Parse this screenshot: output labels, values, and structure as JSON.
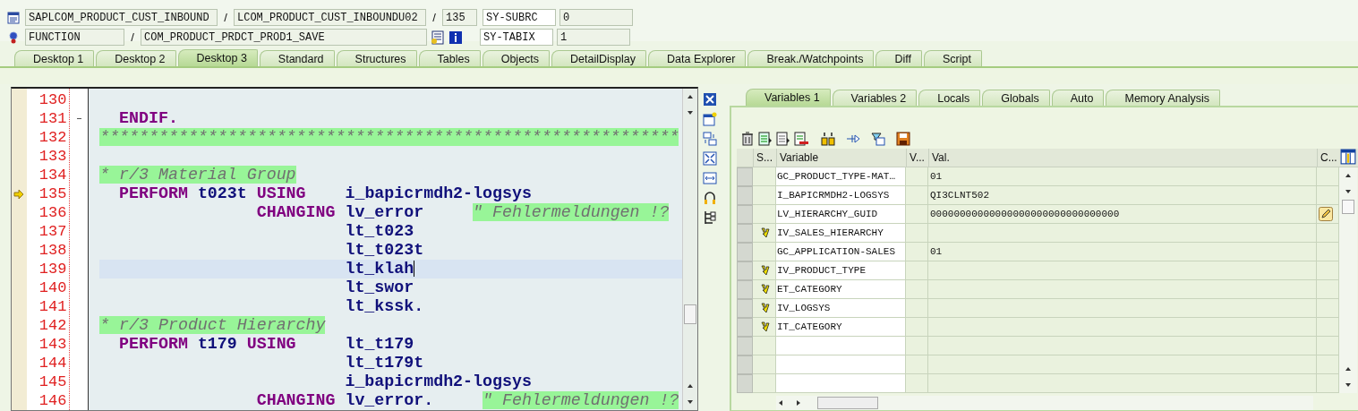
{
  "header": {
    "program": "SAPLCOM_PRODUCT_CUST_INBOUND",
    "include": "LCOM_PRODUCT_CUST_INBOUNDU02",
    "line": "135",
    "subrc_label": "SY-SUBRC",
    "subrc": "0",
    "event_type": "FUNCTION",
    "event_name": "COM_PRODUCT_PRDCT_PROD1_SAVE",
    "tabix_label": "SY-TABIX",
    "tabix": "1",
    "separator": "/"
  },
  "desktop_tabs": [
    {
      "label": "Desktop 1",
      "selected": false
    },
    {
      "label": "Desktop 2",
      "selected": false
    },
    {
      "label": "Desktop 3",
      "selected": true
    },
    {
      "label": "Standard",
      "selected": false
    },
    {
      "label": "Structures",
      "selected": false
    },
    {
      "label": "Tables",
      "selected": false
    },
    {
      "label": "Objects",
      "selected": false
    },
    {
      "label": "DetailDisplay",
      "selected": false
    },
    {
      "label": "Data Explorer",
      "selected": false
    },
    {
      "label": "Break./Watchpoints",
      "selected": false
    },
    {
      "label": "Diff",
      "selected": false
    },
    {
      "label": "Script",
      "selected": false
    }
  ],
  "code_lines": [
    {
      "number": "130",
      "current": false,
      "executing": false,
      "fold": false
    },
    {
      "number": "131",
      "current": false,
      "executing": false,
      "fold": true,
      "segments": [
        {
          "kind": "keyword",
          "t": "  ENDIF."
        }
      ]
    },
    {
      "number": "132",
      "current": false,
      "executing": false,
      "fold": false,
      "segments": [
        {
          "kind": "comment",
          "t": "***********************************************************"
        }
      ]
    },
    {
      "number": "133",
      "current": false,
      "executing": false,
      "fold": false
    },
    {
      "number": "134",
      "current": false,
      "executing": false,
      "fold": false,
      "segments": [
        {
          "kind": "comment",
          "t": "* r/3 Material Group"
        }
      ]
    },
    {
      "number": "135",
      "current": false,
      "executing": true,
      "fold": false,
      "segments": [
        {
          "kind": "keyword",
          "t": "  PERFORM"
        },
        {
          "kind": "identifier",
          "t": " t023t"
        },
        {
          "kind": "keyword",
          "t": " USING"
        },
        {
          "kind": "identifier",
          "t": "    i_bapicrmdh2-logsys"
        }
      ]
    },
    {
      "number": "136",
      "current": false,
      "executing": false,
      "fold": false,
      "segments": [
        {
          "kind": "keyword",
          "t": "                CHANGING"
        },
        {
          "kind": "identifier",
          "t": " lv_error     "
        },
        {
          "kind": "comment",
          "t": "\" Fehlermeldungen !?"
        }
      ]
    },
    {
      "number": "137",
      "current": false,
      "executing": false,
      "fold": false,
      "segments": [
        {
          "kind": "identifier",
          "t": "                         lt_t023"
        }
      ]
    },
    {
      "number": "138",
      "current": false,
      "executing": false,
      "fold": false,
      "segments": [
        {
          "kind": "identifier",
          "t": "                         lt_t023t"
        }
      ]
    },
    {
      "number": "139",
      "current": true,
      "executing": false,
      "fold": false,
      "segments": [
        {
          "kind": "identifier",
          "t": "                         lt_klah"
        }
      ]
    },
    {
      "number": "140",
      "current": false,
      "executing": false,
      "fold": false,
      "segments": [
        {
          "kind": "identifier",
          "t": "                         lt_swor"
        }
      ]
    },
    {
      "number": "141",
      "current": false,
      "executing": false,
      "fold": false,
      "segments": [
        {
          "kind": "identifier",
          "t": "                         lt_kssk."
        }
      ]
    },
    {
      "number": "142",
      "current": false,
      "executing": false,
      "fold": false,
      "segments": [
        {
          "kind": "comment",
          "t": "* r/3 Product Hierarchy"
        }
      ]
    },
    {
      "number": "143",
      "current": false,
      "executing": false,
      "fold": false,
      "segments": [
        {
          "kind": "keyword",
          "t": "  PERFORM"
        },
        {
          "kind": "identifier",
          "t": " t179"
        },
        {
          "kind": "keyword",
          "t": " USING"
        },
        {
          "kind": "identifier",
          "t": "     lt_t179"
        }
      ]
    },
    {
      "number": "144",
      "current": false,
      "executing": false,
      "fold": false,
      "segments": [
        {
          "kind": "identifier",
          "t": "                         lt_t179t"
        }
      ]
    },
    {
      "number": "145",
      "current": false,
      "executing": false,
      "fold": false,
      "segments": [
        {
          "kind": "identifier",
          "t": "                         i_bapicrmdh2-logsys"
        }
      ]
    },
    {
      "number": "146",
      "current": false,
      "executing": false,
      "fold": false,
      "segments": [
        {
          "kind": "keyword",
          "t": "                CHANGING"
        },
        {
          "kind": "identifier",
          "t": " lv_error.     "
        },
        {
          "kind": "comment",
          "t": "\" Fehlermeldungen !?"
        }
      ]
    }
  ],
  "variable_tabs": [
    {
      "label": "Variables 1",
      "selected": true
    },
    {
      "label": "Variables 2",
      "selected": false
    },
    {
      "label": "Locals",
      "selected": false
    },
    {
      "label": "Globals",
      "selected": false
    },
    {
      "label": "Auto",
      "selected": false
    },
    {
      "label": "Memory Analysis",
      "selected": false
    }
  ],
  "table": {
    "columns": [
      "S...",
      "Variable",
      "V...",
      "Val.",
      "C..."
    ],
    "rows": [
      {
        "variable": "GC_PRODUCT_TYPE-MAT…",
        "value": "01",
        "parameter": false,
        "editable": false
      },
      {
        "variable": "I_BAPICRMDH2-LOGSYS",
        "value": "QI3CLNT502",
        "parameter": false,
        "editable": false
      },
      {
        "variable": "LV_HIERARCHY_GUID",
        "value": "00000000000000000000000000000000",
        "parameter": false,
        "editable": true
      },
      {
        "variable": "IV_SALES_HIERARCHY",
        "parameter": true,
        "editable": false
      },
      {
        "variable": "GC_APPLICATION-SALES",
        "value": "01",
        "parameter": false,
        "editable": false
      },
      {
        "variable": "IV_PRODUCT_TYPE",
        "parameter": true,
        "editable": false
      },
      {
        "variable": "ET_CATEGORY",
        "parameter": true,
        "editable": false
      },
      {
        "variable": "IV_LOGSYS",
        "parameter": true,
        "editable": false
      },
      {
        "variable": "IT_CATEGORY",
        "parameter": true,
        "editable": false
      }
    ]
  }
}
